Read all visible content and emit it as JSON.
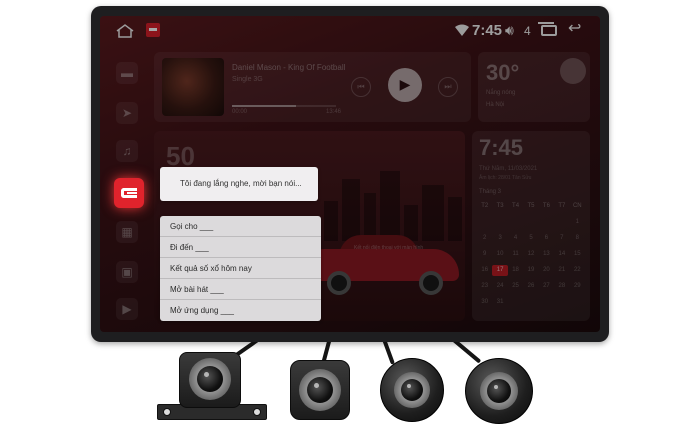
{
  "status_bar": {
    "time": "7:45",
    "volume_level": "4",
    "icons": [
      "home-icon",
      "app-logo-icon",
      "wifi-icon",
      "volume-icon",
      "recent-apps-icon",
      "back-icon"
    ]
  },
  "sidebar": {
    "items": [
      {
        "icon": "video-icon",
        "glyph": "▬"
      },
      {
        "icon": "navigation-icon",
        "glyph": "➤"
      },
      {
        "icon": "music-icon",
        "glyph": "♫"
      },
      {
        "icon": "voice-assistant-icon",
        "glyph": ""
      },
      {
        "icon": "apps-icon",
        "glyph": "▦"
      },
      {
        "icon": "radio-icon",
        "glyph": "▣"
      },
      {
        "icon": "youtube-icon",
        "glyph": "▶"
      }
    ]
  },
  "media": {
    "title": "Daniel Mason - King Of Football",
    "artist": "Single 3G",
    "current_time": "00:00",
    "total_time": "13:46",
    "progress": 0.62
  },
  "weather": {
    "temperature": "30°",
    "description": "Nắng nóng",
    "city": "Hà Nội"
  },
  "map_card": {
    "speed": "50",
    "caption": "Kết nối điện thoại với màn hình"
  },
  "calendar": {
    "time": "7:45",
    "date": "Thứ Năm, 11/03/2021",
    "lunar": "Âm lịch: 28/01 Tân Sửu",
    "month": "Tháng 3",
    "weekdays": [
      "T2",
      "T3",
      "T4",
      "T5",
      "T6",
      "T7",
      "CN"
    ],
    "days": [
      "",
      "",
      "",
      "",
      "",
      "",
      "1",
      "2",
      "3",
      "4",
      "5",
      "6",
      "7",
      "8",
      "9",
      "10",
      "11",
      "12",
      "13",
      "14",
      "15",
      "16",
      "17",
      "18",
      "19",
      "20",
      "21",
      "22",
      "23",
      "24",
      "25",
      "26",
      "27",
      "28",
      "29",
      "30",
      "31"
    ],
    "today": "17"
  },
  "voice_assistant": {
    "prompt": "Tôi đang lắng nghe, mời bạn nói...",
    "suggestions": [
      "Gọi cho ___",
      "Đi đến ___",
      "Kết quả số xổ hôm nay",
      "Mở bài hát ___",
      "Mở ứng dụng ___"
    ]
  },
  "colors": {
    "accent": "#e0232c",
    "screen_bg": "#3d1216",
    "bezel": "#1e1e20"
  }
}
